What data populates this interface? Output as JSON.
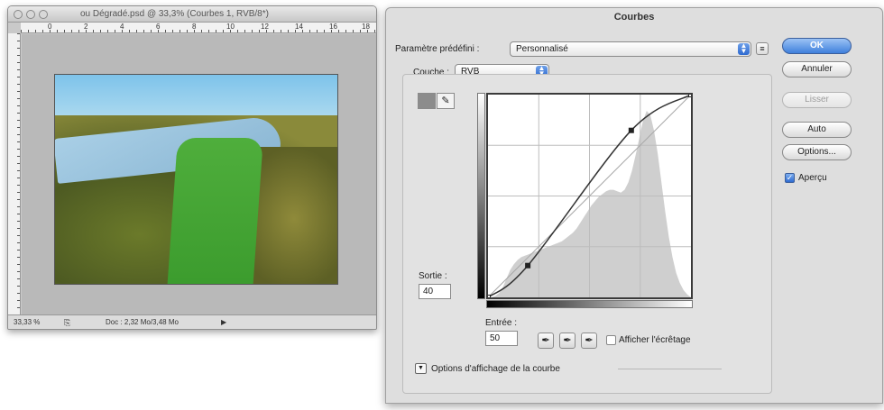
{
  "document": {
    "title": "ou Dégradé.psd @ 33,3% (Courbes 1, RVB/8*)",
    "ruler_marks": [
      "0",
      "2",
      "4",
      "6",
      "8",
      "10",
      "12",
      "14",
      "16",
      "18"
    ],
    "zoom": "33,33 %",
    "doc_size": "Doc : 2,32 Mo/3,48 Mo"
  },
  "dialog": {
    "title": "Courbes",
    "preset_label": "Paramètre prédéfini :",
    "preset_value": "Personnalisé",
    "channel_label": "Couche :",
    "channel_value": "RVB",
    "buttons": {
      "ok": "OK",
      "cancel": "Annuler",
      "smooth": "Lisser",
      "auto": "Auto",
      "options": "Options..."
    },
    "preview_label": "Aperçu",
    "output_label": "Sortie :",
    "output_value": "40",
    "input_label": "Entrée :",
    "input_value": "50",
    "show_clipping_label": "Afficher l'écrêtage",
    "curve_options_label": "Options d'affichage de la courbe"
  },
  "curve": {
    "points": [
      [
        0,
        0
      ],
      [
        50,
        40
      ],
      [
        180,
        210
      ],
      [
        255,
        255
      ]
    ],
    "histogram": [
      0,
      0,
      2,
      6,
      14,
      26,
      38,
      46,
      52,
      56,
      58,
      60,
      62,
      64,
      66,
      68,
      70,
      72,
      74,
      76,
      78,
      82,
      86,
      90,
      96,
      104,
      112,
      120,
      128,
      134,
      140,
      144,
      148,
      150,
      150,
      148,
      146,
      150,
      160,
      176,
      198,
      222,
      246,
      260,
      254,
      232,
      200,
      160,
      120,
      84,
      56,
      34,
      20,
      10,
      4,
      0
    ]
  },
  "colors": {
    "accent": "#3f80dc",
    "histogram": "#cfcfcf",
    "grid": "#bdbdbd"
  }
}
